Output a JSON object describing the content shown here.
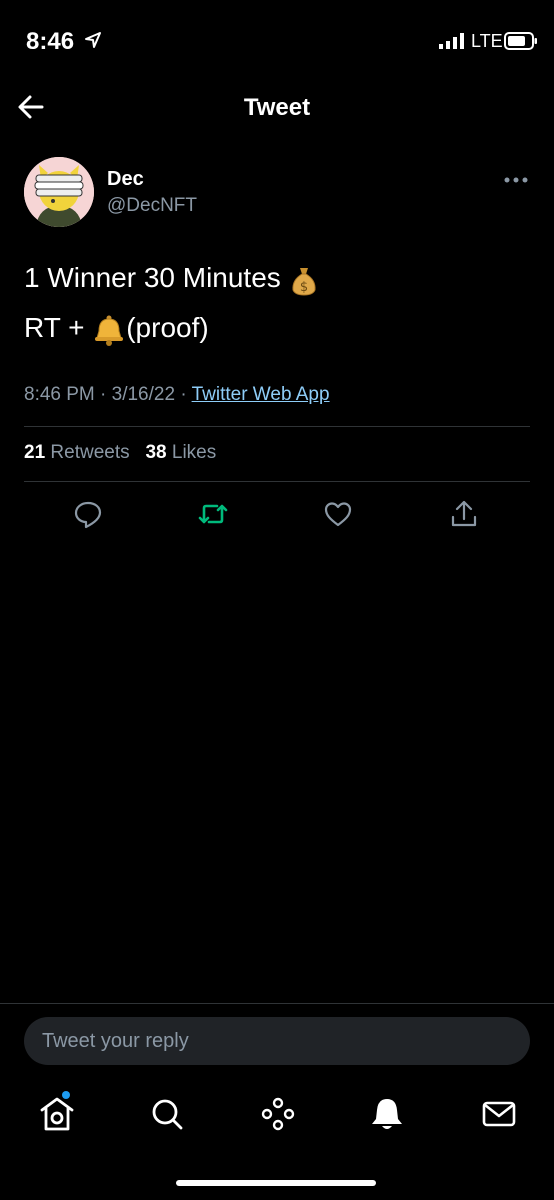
{
  "status_bar": {
    "time": "8:46",
    "network": "LTE"
  },
  "header": {
    "title": "Tweet"
  },
  "tweet": {
    "author_name": "Dec",
    "author_handle": "@DecNFT",
    "line1": "1 Winner 30 Minutes",
    "line1_emoji": "money-bag",
    "line2_prefix": "RT + ",
    "line2_emoji": "bell",
    "line2_suffix": "(proof)",
    "time": "8:46 PM · 3/16/22 · ",
    "source": "Twitter Web App"
  },
  "stats": {
    "retweets_count": "21",
    "retweets_label": "Retweets",
    "likes_count": "38",
    "likes_label": "Likes"
  },
  "reply": {
    "placeholder": "Tweet your reply"
  },
  "colors": {
    "background": "#000000",
    "retweet_active": "#00ba7c",
    "link": "#8ecdf8",
    "accent": "#1d9bf0"
  },
  "tab_bar": [
    "home-icon",
    "search-icon",
    "spaces-icon",
    "notifications-icon",
    "messages-icon"
  ]
}
